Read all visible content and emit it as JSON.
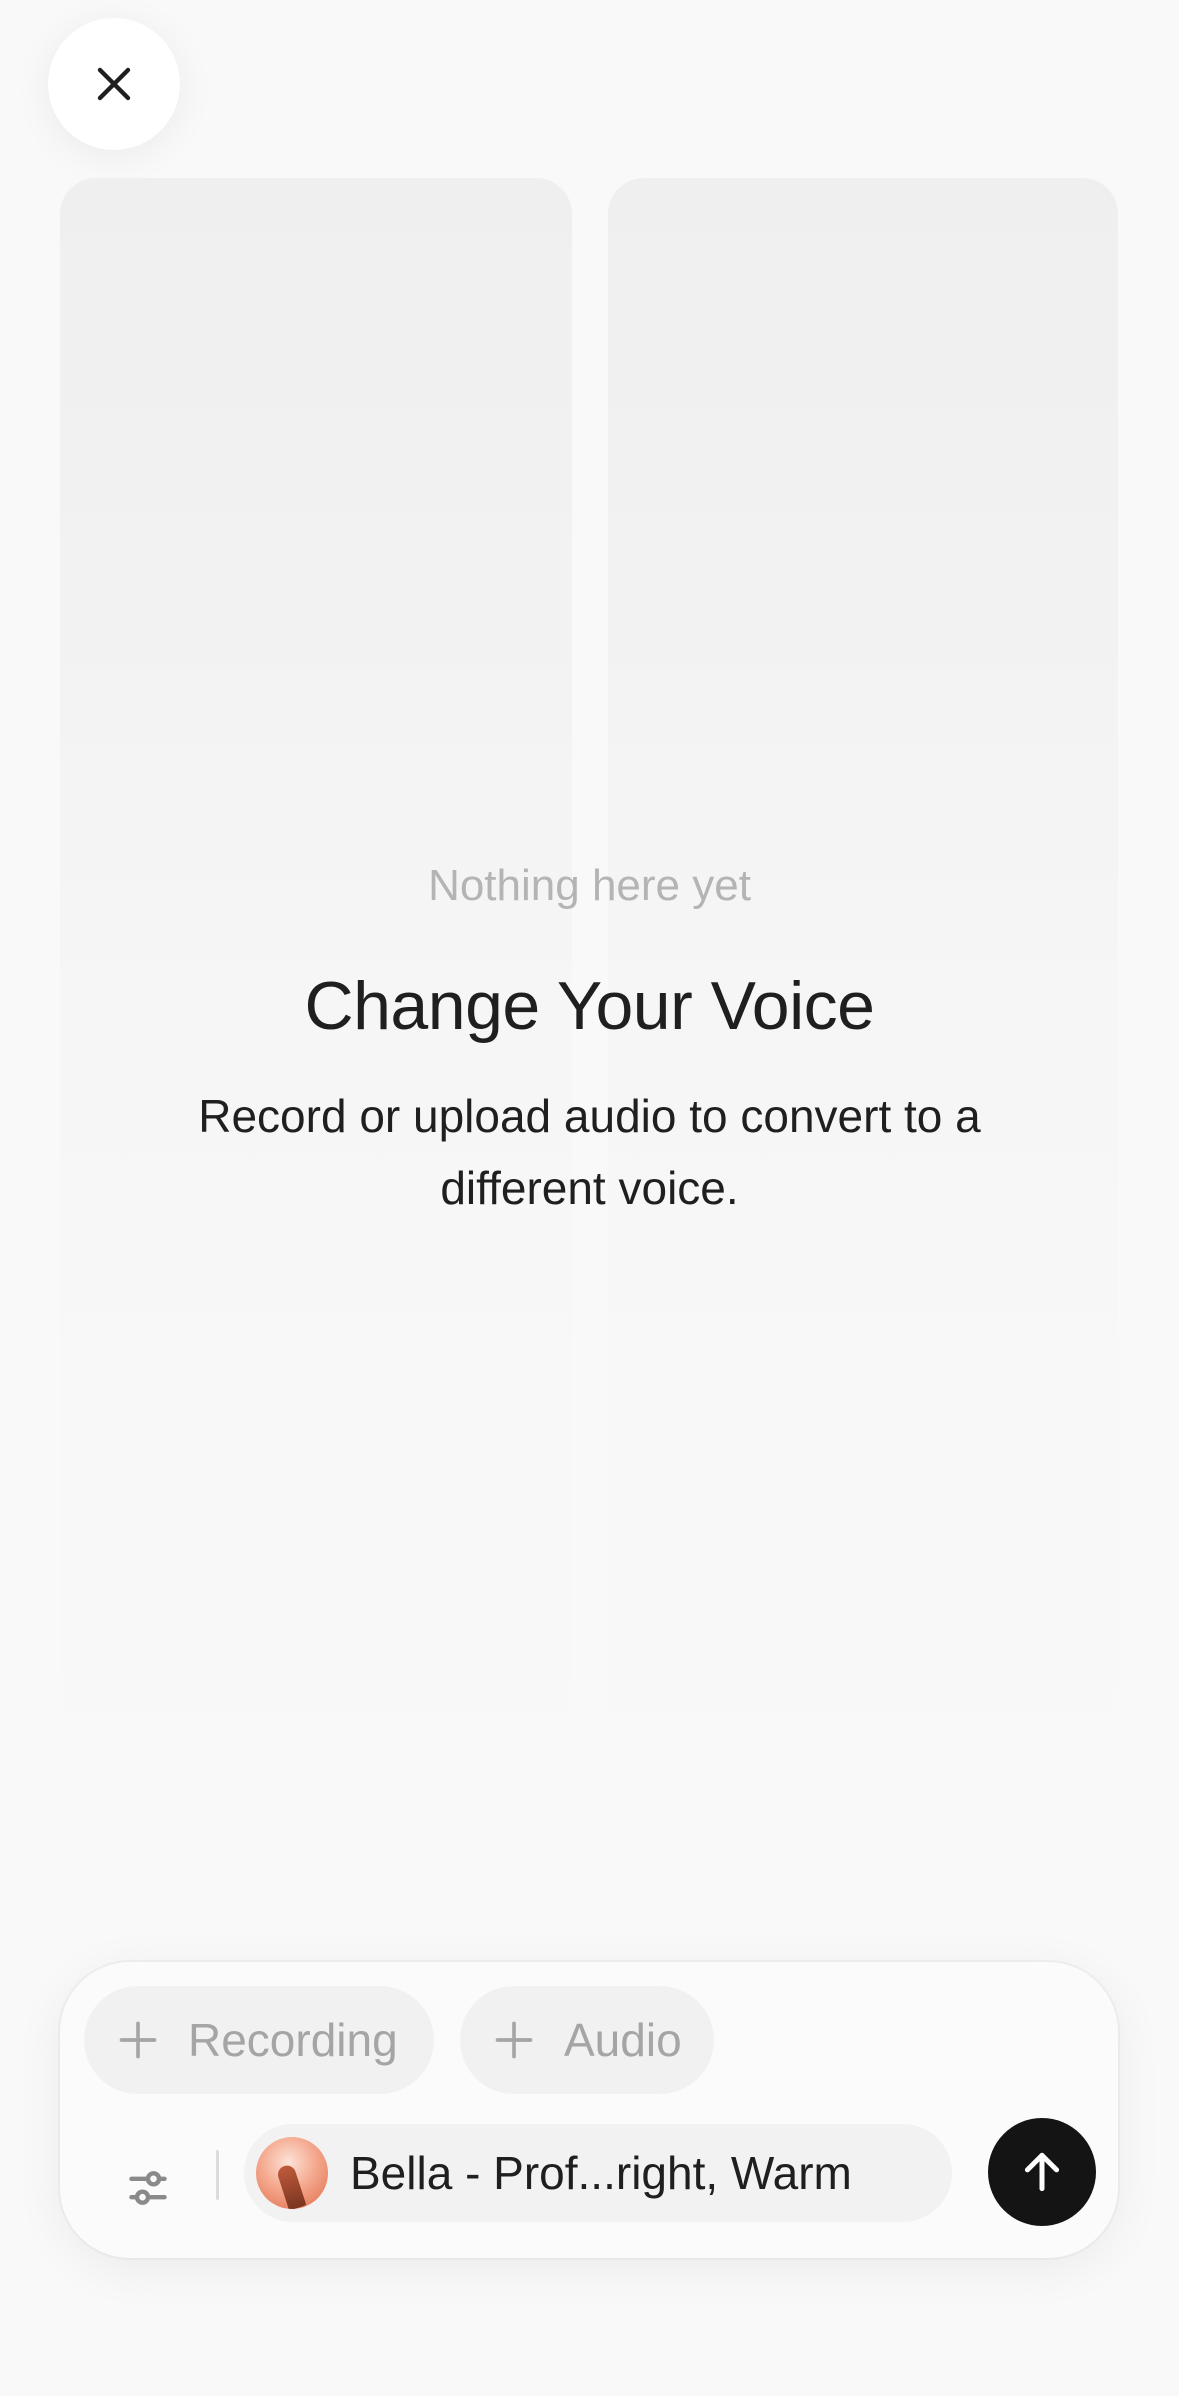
{
  "header": {
    "close_icon": "close-icon"
  },
  "empty_state": {
    "hint": "Nothing here yet",
    "title": "Change Your Voice",
    "description": "Record or upload audio to convert to a different voice."
  },
  "composer": {
    "chips": [
      {
        "label": "Recording",
        "icon": "plus-icon"
      },
      {
        "label": "Audio",
        "icon": "plus-icon"
      }
    ],
    "settings_icon": "sliders-icon",
    "voice": {
      "name": "Bella - Prof...right, Warm",
      "avatar_icon": "voice-avatar"
    },
    "send_icon": "arrow-up-icon"
  },
  "colors": {
    "background": "#f9f9f9",
    "send_button": "#141414",
    "hint_text": "#b4b4b4",
    "chip_text": "#a5a5a5"
  }
}
